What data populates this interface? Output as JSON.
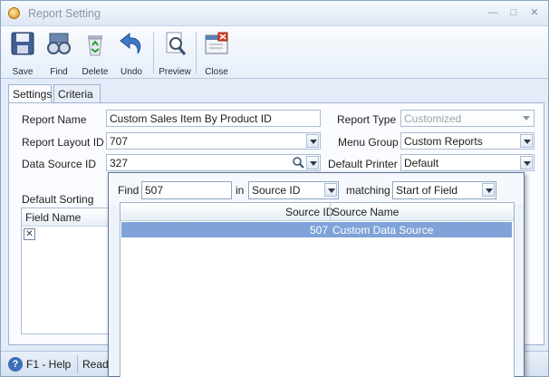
{
  "window": {
    "title": "Report Setting"
  },
  "toolbar": {
    "buttons": [
      {
        "label": "Save",
        "icon": "save-icon"
      },
      {
        "label": "Find",
        "icon": "binoculars-icon"
      },
      {
        "label": "Delete",
        "icon": "recycle-bin-icon"
      },
      {
        "label": "Undo",
        "icon": "undo-icon"
      },
      {
        "label": "Preview",
        "icon": "magnifier-page-icon"
      },
      {
        "label": "Close",
        "icon": "close-window-icon"
      }
    ]
  },
  "tabs": [
    {
      "label": "Settings"
    },
    {
      "label": "Criteria"
    }
  ],
  "form": {
    "report_name": {
      "label": "Report Name",
      "value": "Custom Sales Item By Product ID"
    },
    "report_type": {
      "label": "Report Type",
      "value": "Customized"
    },
    "report_layout_id": {
      "label": "Report Layout ID",
      "value": "707"
    },
    "menu_group": {
      "label": "Menu Group",
      "value": "Custom Reports"
    },
    "data_source_id": {
      "label": "Data Source ID",
      "value": "327"
    },
    "default_printer": {
      "label": "Default Printer",
      "value": "Default"
    },
    "default_sorting": {
      "label": "Default Sorting"
    },
    "sorting_grid": {
      "column": "Field Name"
    }
  },
  "lookup": {
    "find_label": "Find",
    "find_value": "507",
    "in_label": "in",
    "in_value": "Source ID",
    "matching_label": "matching",
    "matching_value": "Start of Field",
    "columns": [
      "Source ID",
      "Source Name"
    ],
    "rows": [
      {
        "source_id": "507",
        "source_name": "Custom Data Source"
      }
    ]
  },
  "status": {
    "help": "F1 - Help",
    "ready": "Ready"
  },
  "colors": {
    "selection": "#7fa2d8",
    "frame": "#8aa3c6"
  }
}
